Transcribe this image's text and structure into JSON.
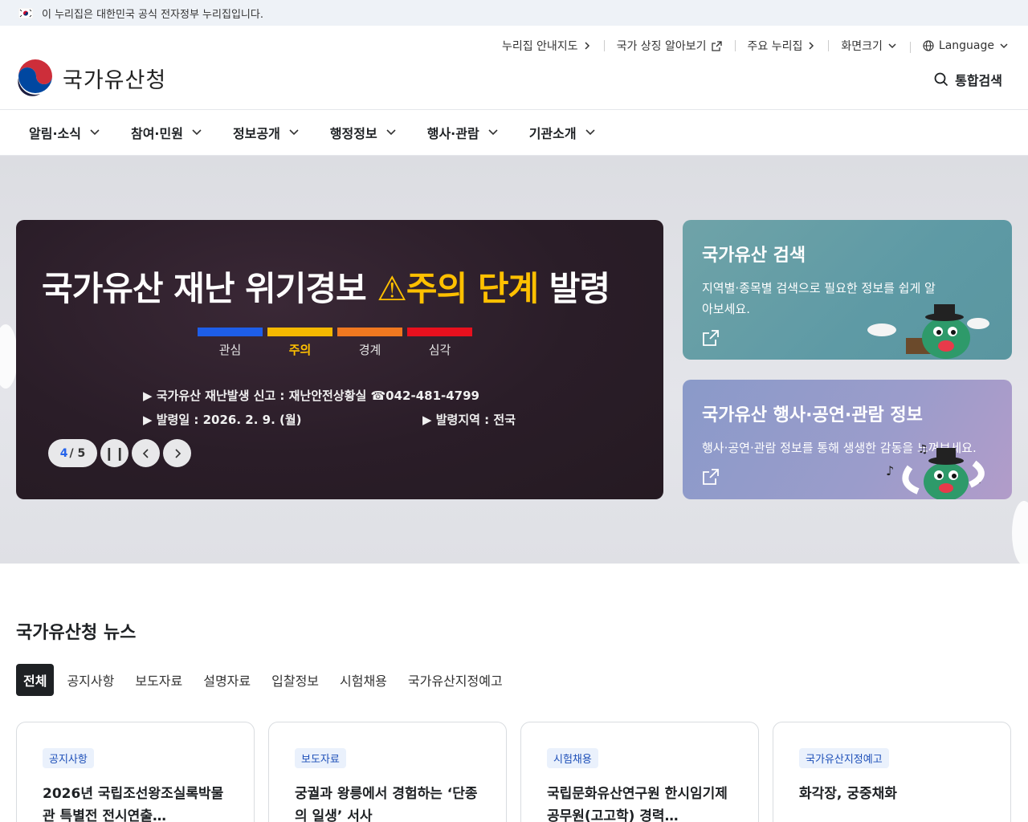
{
  "gov_banner": {
    "text": "이 누리집은 대한민국 공식 전자정부 누리집입니다."
  },
  "header": {
    "logo_text": "국가유산청",
    "utility": [
      {
        "label": "누리집 안내지도",
        "icon": "chevron-right-icon"
      },
      {
        "label": "국가 상징 알아보기",
        "icon": "external-link-icon"
      },
      {
        "label": "주요 누리집",
        "icon": "chevron-right-icon"
      },
      {
        "label": "화면크기",
        "icon": "chevron-down-icon"
      },
      {
        "label": "Language",
        "icon": "chevron-down-icon"
      }
    ],
    "search_label": "통합검색"
  },
  "gnb": [
    "알림·소식",
    "참여·민원",
    "정보공개",
    "행정정보",
    "행사·관람",
    "기관소개"
  ],
  "hero": {
    "banner": {
      "title_main": "국가유산 재난 위기경보",
      "title_warn": "⚠주의 단계",
      "title_end": "발령",
      "levels": [
        {
          "label": "관심",
          "color": "#1e5ee8"
        },
        {
          "label": "주의",
          "color": "#f5b800"
        },
        {
          "label": "경계",
          "color": "#f07820"
        },
        {
          "label": "심각",
          "color": "#e8101e"
        }
      ],
      "active_level": "주의",
      "report_line": "▶ 국가유산 재난발생 신고 : 재난안전상황실 ☎042-481-4799",
      "date_line": "▶ 발령일 : 2026. 2. 9. (월)",
      "region_line": "▶ 발령지역 : 전국"
    },
    "pager": {
      "current": "4",
      "total": "/ 5"
    },
    "cards": [
      {
        "title": "국가유산 검색",
        "desc": "지역별·종목별 검색으로 필요한 정보를 쉽게 알아보세요."
      },
      {
        "title": "국가유산 행사·공연·관람 정보",
        "desc": "행사·공연·관람 정보를 통해 생생한 감동을 느껴보세요."
      }
    ]
  },
  "news": {
    "title": "국가유산청 뉴스",
    "tabs": [
      "전체",
      "공지사항",
      "보도자료",
      "설명자료",
      "입찰정보",
      "시험채용",
      "국가유산지정예고"
    ],
    "active_tab": "전체",
    "cards": [
      {
        "badge": "공지사항",
        "title": "2026년 국립조선왕조실록박물관 특별전 전시연출…"
      },
      {
        "badge": "보도자료",
        "title": "궁궐과 왕릉에서 경험하는 ‘단종의 일생’ 서사"
      },
      {
        "badge": "시험채용",
        "title": "국립문화유산연구원 한시임기제공무원(고고학) 경력…"
      },
      {
        "badge": "국가유산지정예고",
        "title": "화각장, 궁중채화"
      }
    ]
  }
}
